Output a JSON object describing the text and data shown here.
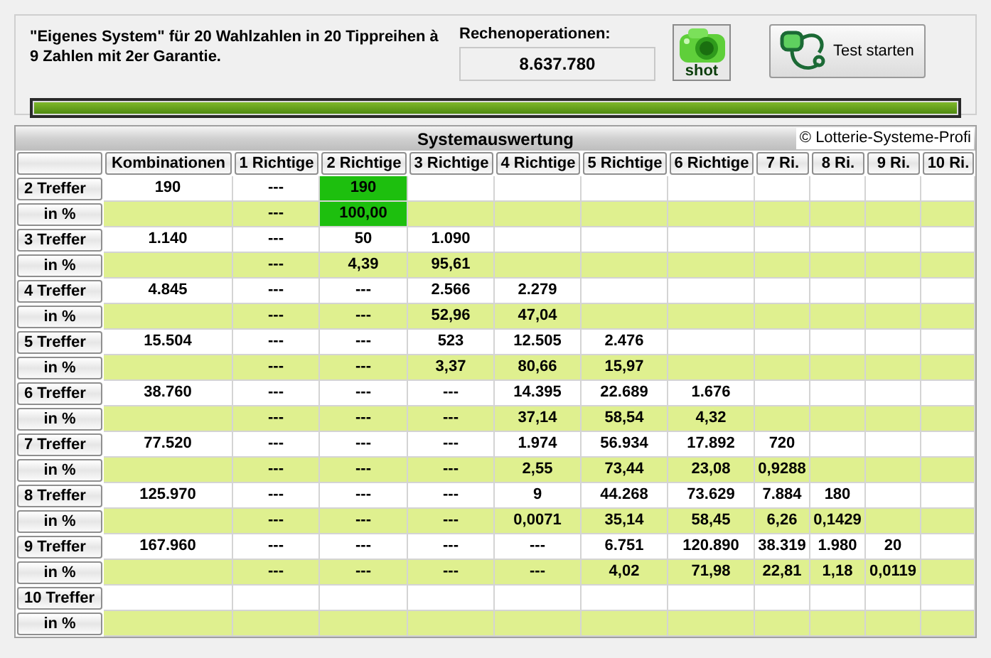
{
  "description": "\"Eigenes System\" für 20 Wahlzahlen in 20 Tippreihen à 9 Zahlen mit 2er Garantie.",
  "operations": {
    "label": "Rechenoperationen:",
    "value": "8.637.780"
  },
  "shot_button": {
    "label": "shot"
  },
  "test_button": {
    "label": "Test starten"
  },
  "progress": {
    "level": 1
  },
  "table": {
    "title": "Systemauswertung",
    "copyright": "© Lotterie-Systeme-Profi",
    "columns": [
      "Kombinationen",
      "1 Richtige",
      "2 Richtige",
      "3 Richtige",
      "4 Richtige",
      "5 Richtige",
      "6 Richtige",
      "7 Ri.",
      "8 Ri.",
      "9 Ri.",
      "10 Ri."
    ],
    "rows": [
      {
        "label": "2 Treffer",
        "kind": "count",
        "cells": [
          "190",
          "---",
          {
            "text": "190",
            "highlighted": true
          },
          null,
          null,
          null,
          null,
          null,
          null,
          null,
          null
        ]
      },
      {
        "label": "in %",
        "kind": "percent",
        "cells": [
          null,
          "---",
          {
            "text": "100,00",
            "highlighted": true
          },
          null,
          null,
          null,
          null,
          null,
          null,
          null,
          null
        ]
      },
      {
        "label": "3 Treffer",
        "kind": "count",
        "cells": [
          "1.140",
          "---",
          "50",
          "1.090",
          null,
          null,
          null,
          null,
          null,
          null,
          null
        ]
      },
      {
        "label": "in %",
        "kind": "percent",
        "cells": [
          null,
          "---",
          "4,39",
          "95,61",
          null,
          null,
          null,
          null,
          null,
          null,
          null
        ]
      },
      {
        "label": "4 Treffer",
        "kind": "count",
        "cells": [
          "4.845",
          "---",
          "---",
          "2.566",
          "2.279",
          null,
          null,
          null,
          null,
          null,
          null
        ]
      },
      {
        "label": "in %",
        "kind": "percent",
        "cells": [
          null,
          "---",
          "---",
          "52,96",
          "47,04",
          null,
          null,
          null,
          null,
          null,
          null
        ]
      },
      {
        "label": "5 Treffer",
        "kind": "count",
        "cells": [
          "15.504",
          "---",
          "---",
          "523",
          "12.505",
          "2.476",
          null,
          null,
          null,
          null,
          null
        ]
      },
      {
        "label": "in %",
        "kind": "percent",
        "cells": [
          null,
          "---",
          "---",
          "3,37",
          "80,66",
          "15,97",
          null,
          null,
          null,
          null,
          null
        ]
      },
      {
        "label": "6 Treffer",
        "kind": "count",
        "cells": [
          "38.760",
          "---",
          "---",
          "---",
          "14.395",
          "22.689",
          "1.676",
          null,
          null,
          null,
          null
        ]
      },
      {
        "label": "in %",
        "kind": "percent",
        "cells": [
          null,
          "---",
          "---",
          "---",
          "37,14",
          "58,54",
          "4,32",
          null,
          null,
          null,
          null
        ]
      },
      {
        "label": "7 Treffer",
        "kind": "count",
        "cells": [
          "77.520",
          "---",
          "---",
          "---",
          "1.974",
          "56.934",
          "17.892",
          "720",
          null,
          null,
          null
        ]
      },
      {
        "label": "in %",
        "kind": "percent",
        "cells": [
          null,
          "---",
          "---",
          "---",
          "2,55",
          "73,44",
          "23,08",
          "0,9288",
          null,
          null,
          null
        ]
      },
      {
        "label": "8 Treffer",
        "kind": "count",
        "cells": [
          "125.970",
          "---",
          "---",
          "---",
          "9",
          "44.268",
          "73.629",
          "7.884",
          "180",
          null,
          null
        ]
      },
      {
        "label": "in %",
        "kind": "percent",
        "cells": [
          null,
          "---",
          "---",
          "---",
          "0,0071",
          "35,14",
          "58,45",
          "6,26",
          "0,1429",
          null,
          null
        ]
      },
      {
        "label": "9 Treffer",
        "kind": "count",
        "cells": [
          "167.960",
          "---",
          "---",
          "---",
          "---",
          "6.751",
          "120.890",
          "38.319",
          "1.980",
          "20",
          null
        ]
      },
      {
        "label": "in %",
        "kind": "percent",
        "cells": [
          null,
          "---",
          "---",
          "---",
          "---",
          "4,02",
          "71,98",
          "22,81",
          "1,18",
          "0,0119",
          null
        ]
      },
      {
        "label": "10 Treffer",
        "kind": "count",
        "cells": [
          null,
          null,
          null,
          null,
          null,
          null,
          null,
          null,
          null,
          null,
          null
        ]
      },
      {
        "label": "in %",
        "kind": "percent",
        "cells": [
          null,
          null,
          null,
          null,
          null,
          null,
          null,
          null,
          null,
          null,
          null
        ]
      }
    ]
  }
}
